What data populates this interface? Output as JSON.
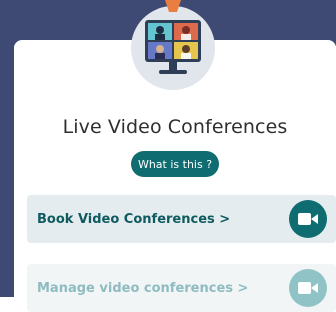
{
  "header": {},
  "main": {
    "title": "Live Video Conferences",
    "what_is_this": "What is this ?",
    "book_label": "Book Video Conferences >",
    "manage_label": "Manage video conferences >"
  },
  "icons": {
    "illustration": "video-conference-illustration",
    "book": "video-camera-icon",
    "manage": "video-camera-icon"
  },
  "colors": {
    "header_bg": "#3f4a74",
    "accent": "#0f6c70",
    "row_bg": "#e5ecef"
  }
}
